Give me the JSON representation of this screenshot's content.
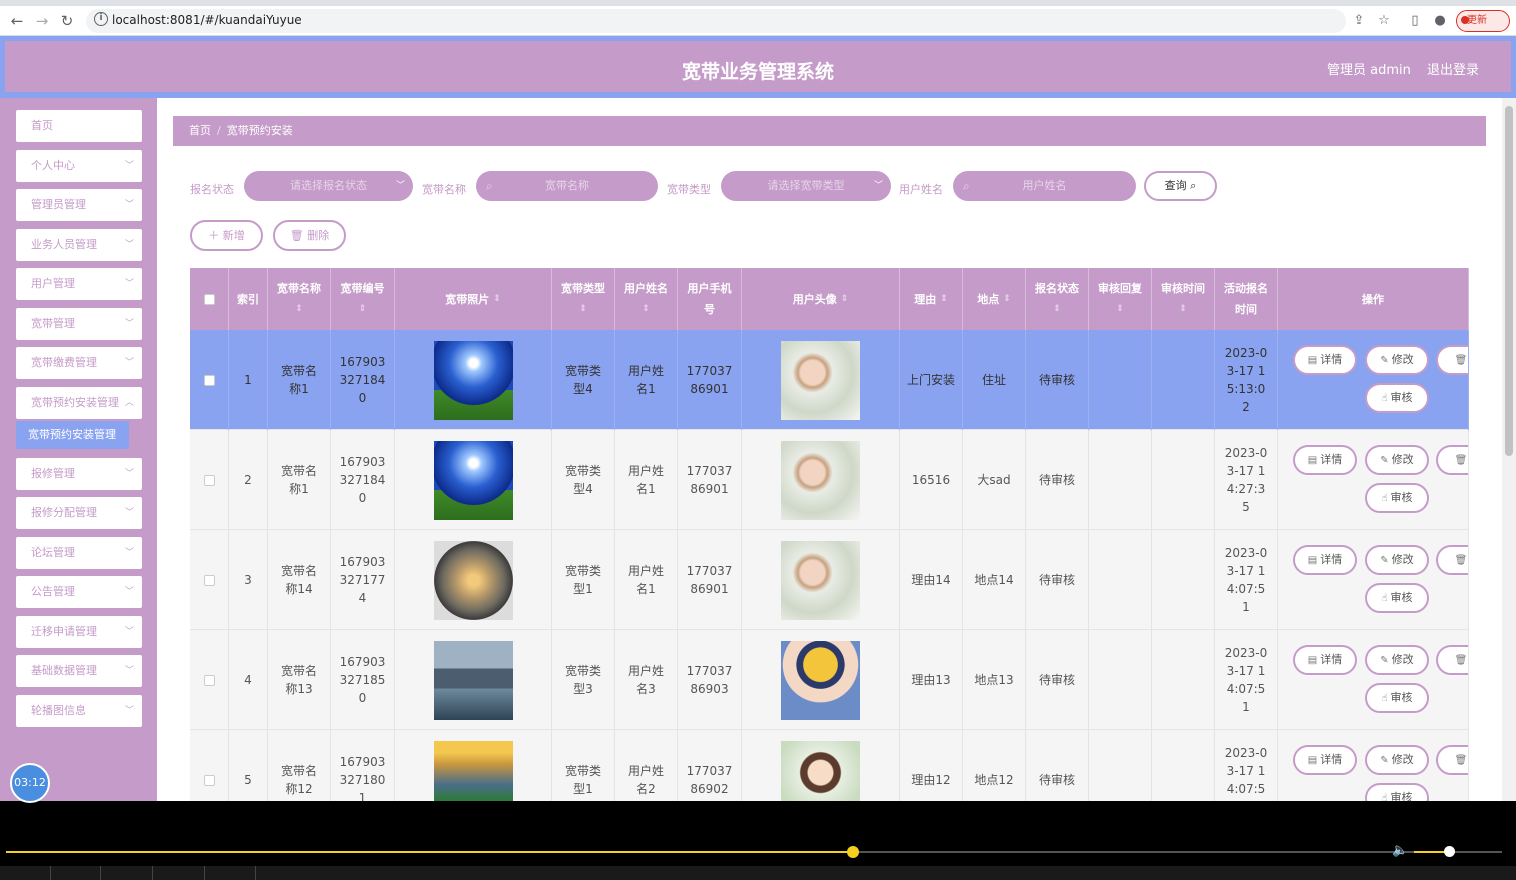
{
  "browser": {
    "url": "localhost:8081/#/kuandaiYuyue",
    "update_label": "更新"
  },
  "header": {
    "title": "宽带业务管理系统",
    "user": "管理员 admin",
    "logout": "退出登录"
  },
  "sidebar": {
    "items": [
      {
        "label": "首页"
      },
      {
        "label": "个人中心"
      },
      {
        "label": "管理员管理"
      },
      {
        "label": "业务人员管理"
      },
      {
        "label": "用户管理"
      },
      {
        "label": "宽带管理"
      },
      {
        "label": "宽带缴费管理"
      },
      {
        "label": "宽带预约安装管理"
      },
      {
        "label": "报修管理"
      },
      {
        "label": "报修分配管理"
      },
      {
        "label": "论坛管理"
      },
      {
        "label": "公告管理"
      },
      {
        "label": "迁移申请管理"
      },
      {
        "label": "基础数据管理"
      },
      {
        "label": "轮播图信息"
      }
    ],
    "active_sub": "宽带预约安装管理"
  },
  "breadcrumb": {
    "home": "首页",
    "sep": "/",
    "current": "宽带预约安装"
  },
  "filters": {
    "status_label": "报名状态",
    "status_placeholder": "请选择报名状态",
    "name_label": "宽带名称",
    "name_placeholder": "宽带名称",
    "type_label": "宽带类型",
    "type_placeholder": "请选择宽带类型",
    "user_label": "用户姓名",
    "user_placeholder": "用户姓名",
    "query": "查询"
  },
  "actions": {
    "add": "新增",
    "delete": "删除"
  },
  "table": {
    "headers": [
      "索引",
      "宽带名称",
      "宽带编号",
      "宽带照片",
      "宽带类型",
      "用户姓名",
      "用户手机号",
      "用户头像",
      "理由",
      "地点",
      "报名状态",
      "审核回复",
      "审核时间",
      "活动报名时间",
      "操作"
    ],
    "op_labels": {
      "detail": "详情",
      "edit": "修改",
      "delete": "删",
      "review": "审核"
    },
    "rows": [
      {
        "index": "1",
        "name": "宽带名称1",
        "code": "1679033271840",
        "type": "宽带类型4",
        "user": "用户姓名1",
        "phone": "17703786901",
        "reason": "上门安装",
        "place": "住址",
        "status": "待审核",
        "reply": "",
        "review_time": "",
        "signup_time": "2023-03-17 15:13:02",
        "selected": true
      },
      {
        "index": "2",
        "name": "宽带名称1",
        "code": "1679033271840",
        "type": "宽带类型4",
        "user": "用户姓名1",
        "phone": "17703786901",
        "reason": "16516",
        "place": "大sad",
        "status": "待审核",
        "reply": "",
        "review_time": "",
        "signup_time": "2023-03-17 14:27:35",
        "selected": false
      },
      {
        "index": "3",
        "name": "宽带名称14",
        "code": "1679033271774",
        "type": "宽带类型1",
        "user": "用户姓名1",
        "phone": "17703786901",
        "reason": "理由14",
        "place": "地点14",
        "status": "待审核",
        "reply": "",
        "review_time": "",
        "signup_time": "2023-03-17 14:07:51",
        "selected": false
      },
      {
        "index": "4",
        "name": "宽带名称13",
        "code": "1679033271850",
        "type": "宽带类型3",
        "user": "用户姓名3",
        "phone": "17703786903",
        "reason": "理由13",
        "place": "地点13",
        "status": "待审核",
        "reply": "",
        "review_time": "",
        "signup_time": "2023-03-17 14:07:51",
        "selected": false
      },
      {
        "index": "5",
        "name": "宽带名称12",
        "code": "1679033271801",
        "type": "宽带类型1",
        "user": "用户姓名2",
        "phone": "17703786902",
        "reason": "理由12",
        "place": "地点12",
        "status": "待审核",
        "reply": "",
        "review_time": "",
        "signup_time": "2023-03-17 14:07:51",
        "selected": false
      }
    ]
  },
  "video": {
    "timer": "03:12",
    "progress": 0.566,
    "volume": 0.4
  },
  "colors": {
    "accent": "#c59bc9",
    "highlight": "#8aa3f0"
  }
}
